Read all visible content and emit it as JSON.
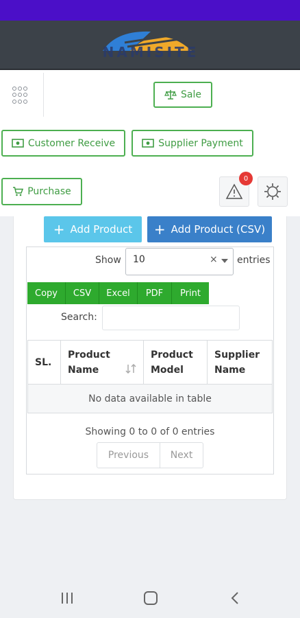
{
  "brand": {
    "logo_text": "NAMISITE",
    "logo_colors": [
      "#2f7fd6",
      "#f0a92a"
    ]
  },
  "toolbar": {
    "sale_label": "Sale",
    "customer_receive_label": "Customer Receive",
    "supplier_payment_label": "Supplier Payment",
    "purchase_label": "Purchase",
    "notification_count": "0"
  },
  "actions": {
    "add_product_label": "Add Product",
    "add_product_csv_label": "Add Product (CSV)"
  },
  "datatable": {
    "show_label": "Show",
    "page_size": "10",
    "clear_symbol": "×",
    "entries_label": "entries",
    "export_buttons": [
      "Copy",
      "CSV",
      "Excel",
      "PDF",
      "Print"
    ],
    "search_label": "Search:",
    "search_value": "",
    "columns": [
      "SL.",
      "Product Name",
      "Product Model",
      "Supplier Name"
    ],
    "empty_message": "No data available in table",
    "info_text": "Showing 0 to 0 of 0 entries",
    "previous_label": "Previous",
    "next_label": "Next"
  },
  "colors": {
    "accent_green": "#4caf50",
    "export_green": "#2eaa2e",
    "add_light_blue": "#5bc6ea",
    "add_blue": "#3a80c9",
    "status_purple": "#4b0fc8",
    "badge_red": "#e53935"
  }
}
